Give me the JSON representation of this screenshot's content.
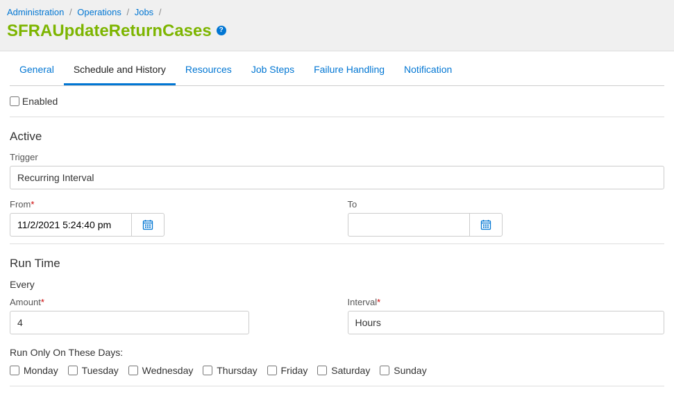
{
  "breadcrumb": {
    "items": [
      "Administration",
      "Operations",
      "Jobs"
    ]
  },
  "page_title": "SFRAUpdateReturnCases",
  "help_glyph": "?",
  "tabs": {
    "general": "General",
    "schedule": "Schedule and History",
    "resources": "Resources",
    "jobsteps": "Job Steps",
    "failure": "Failure Handling",
    "notification": "Notification"
  },
  "enabled": {
    "label": "Enabled"
  },
  "active": {
    "heading": "Active",
    "trigger_label": "Trigger",
    "trigger_value": "Recurring Interval",
    "from_label": "From",
    "from_value": "11/2/2021 5:24:40 pm",
    "to_label": "To",
    "to_value": ""
  },
  "runtime": {
    "heading": "Run Time",
    "every_label": "Every",
    "amount_label": "Amount",
    "amount_value": "4",
    "interval_label": "Interval",
    "interval_value": "Hours"
  },
  "days": {
    "heading": "Run Only On These Days:",
    "items": [
      "Monday",
      "Tuesday",
      "Wednesday",
      "Thursday",
      "Friday",
      "Saturday",
      "Sunday"
    ]
  },
  "required_marker": "*"
}
